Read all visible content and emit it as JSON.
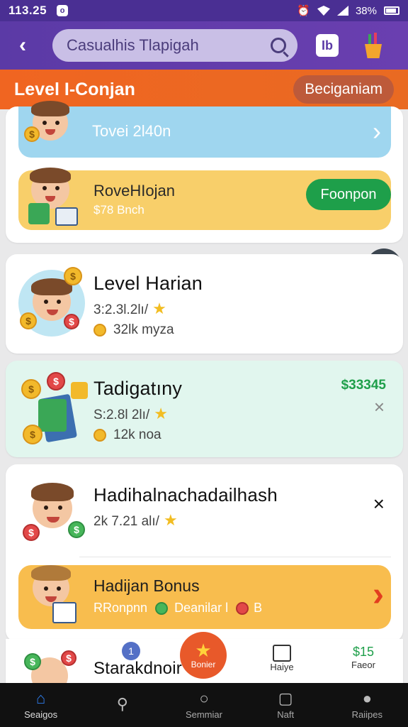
{
  "status_bar": {
    "time": "113.25",
    "notif_badge": "o",
    "battery": "38%"
  },
  "header": {
    "back_icon": "chevron-left-icon",
    "search_text": "Casualhis Tlapigah",
    "action_icon_text": "Ib"
  },
  "level_bar": {
    "title": "Level I-Conjan",
    "button": "Beciganiam"
  },
  "top_card": {
    "row1": {
      "label": "Tovei 2l40n"
    },
    "row2": {
      "title": "RoveHIojan",
      "sub": "$78 Bnch",
      "button": "Foonpon"
    }
  },
  "cards": [
    {
      "title": "Level Harian",
      "line1": "3:2.3l.2lı/",
      "line2": "32lk myza"
    },
    {
      "title": "Tadigatıny",
      "line1": "S:2.8l 2lı/",
      "line2": "12k noa",
      "amount": "$33345"
    },
    {
      "title": "Hadihalnachadailhash",
      "line1": "2k 7.21 alı/"
    }
  ],
  "bonus": {
    "title": "Hadijan Bonus",
    "sub_a": "RRonpnn",
    "sub_b": "Deanilar l",
    "sub_c": "B"
  },
  "bottom_card": {
    "title": "Starakdnoir",
    "float_left": "Bonier",
    "float_mid": "Haiye",
    "float_right": "Faeor",
    "amount": "$15"
  },
  "nav": {
    "items": [
      {
        "label": "Seaigos",
        "icon": "home-icon"
      },
      {
        "label": "",
        "icon": "search-icon"
      },
      {
        "label": "Semmiar",
        "icon": "search-icon"
      },
      {
        "label": "Naft",
        "icon": "notification-icon"
      },
      {
        "label": "Raiipes",
        "icon": "profile-icon"
      }
    ]
  },
  "colors": {
    "purple": "#5b3aa6",
    "orange": "#f06521",
    "green": "#1e9f4a",
    "blue": "#9fd6ef",
    "yellow": "#f8cf6a"
  }
}
